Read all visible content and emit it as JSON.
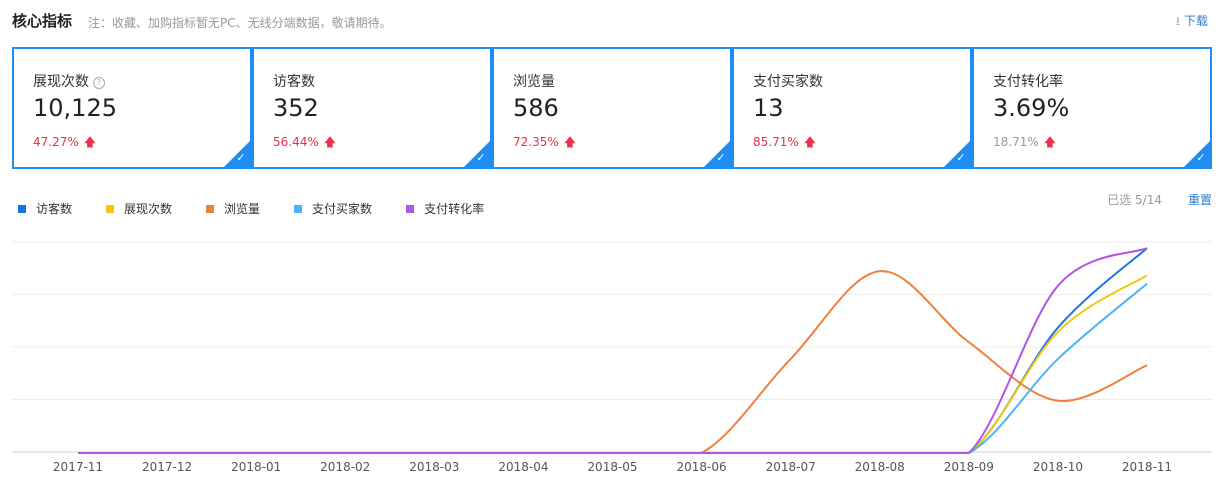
{
  "header": {
    "title": "核心指标",
    "note": "注：收藏、加购指标暂无PC、无线分端数据，敬请期待。",
    "download_label": "下载"
  },
  "cards": [
    {
      "label": "展现次数",
      "value": "10,125",
      "change": "47.27%",
      "change_color": "#e8314a",
      "help": "?"
    },
    {
      "label": "访客数",
      "value": "352",
      "change": "56.44%",
      "change_color": "#e8314a"
    },
    {
      "label": "浏览量",
      "value": "586",
      "change": "72.35%",
      "change_color": "#e8314a"
    },
    {
      "label": "支付买家数",
      "value": "13",
      "change": "85.71%",
      "change_color": "#e8314a"
    },
    {
      "label": "支付转化率",
      "value": "3.69%",
      "change": "18.71%",
      "change_color": "#999999"
    }
  ],
  "selection": {
    "selected_text": "已选 5/14",
    "reset_label": "重置"
  },
  "icons": {
    "check": "check-icon",
    "arrow": "arrow-up-icon",
    "download": "download-icon",
    "help": "help-icon"
  },
  "chart_data": {
    "type": "line",
    "categories": [
      "2017-11",
      "2017-12",
      "2018-01",
      "2018-02",
      "2018-03",
      "2018-04",
      "2018-05",
      "2018-06",
      "2018-07",
      "2018-08",
      "2018-09",
      "2018-10",
      "2018-11"
    ],
    "ylim": [
      0,
      1
    ],
    "grid": true,
    "legend_position": "top-left",
    "series": [
      {
        "name": "访客数",
        "color": "#1a73e8",
        "values": [
          0,
          0,
          0,
          0,
          0,
          0,
          0,
          0,
          0,
          0,
          0,
          0.6,
          0.98
        ]
      },
      {
        "name": "展现次数",
        "color": "#f2c811",
        "values": [
          0,
          0,
          0,
          0,
          0,
          0,
          0,
          0,
          0,
          0,
          0,
          0.58,
          0.85
        ]
      },
      {
        "name": "浏览量",
        "color": "#f0803c",
        "values": [
          0,
          0,
          0,
          0,
          0,
          0,
          0,
          0,
          0.45,
          0.87,
          0.53,
          0.25,
          0.42
        ]
      },
      {
        "name": "支付买家数",
        "color": "#4db3f5",
        "values": [
          0,
          0,
          0,
          0,
          0,
          0,
          0,
          0,
          0,
          0,
          0,
          0.45,
          0.81
        ]
      },
      {
        "name": "支付转化率",
        "color": "#b157e0",
        "values": [
          0,
          0,
          0,
          0,
          0,
          0,
          0,
          0,
          0,
          0,
          0,
          0.8,
          0.98
        ]
      }
    ]
  }
}
